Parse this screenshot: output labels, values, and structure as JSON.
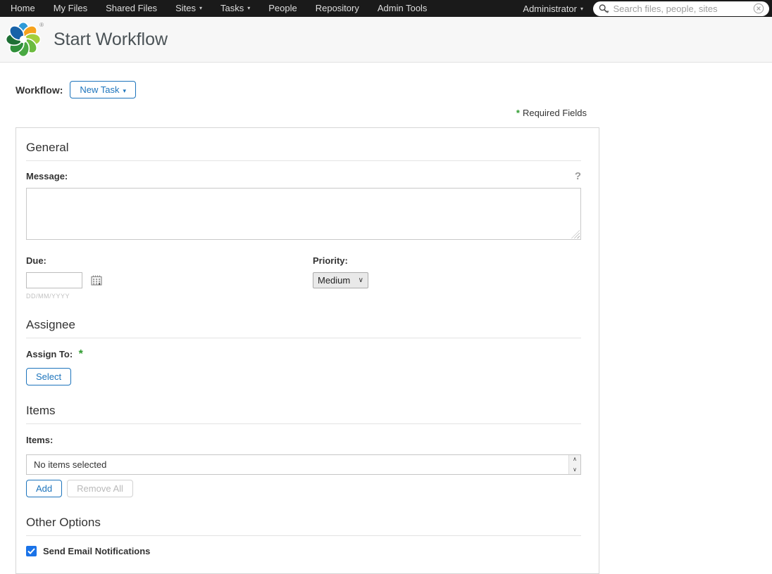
{
  "nav": {
    "items": [
      {
        "label": "Home",
        "has_dropdown": false
      },
      {
        "label": "My Files",
        "has_dropdown": false
      },
      {
        "label": "Shared Files",
        "has_dropdown": false
      },
      {
        "label": "Sites",
        "has_dropdown": true
      },
      {
        "label": "Tasks",
        "has_dropdown": true
      },
      {
        "label": "People",
        "has_dropdown": false
      },
      {
        "label": "Repository",
        "has_dropdown": false
      },
      {
        "label": "Admin Tools",
        "has_dropdown": false
      }
    ],
    "user_menu_label": "Administrator",
    "search": {
      "placeholder": "Search files, people, sites"
    }
  },
  "header": {
    "title": "Start Workflow"
  },
  "workflow": {
    "label": "Workflow:",
    "selector_button": "New Task"
  },
  "required_note": {
    "star": "*",
    "text": "Required Fields"
  },
  "form": {
    "general": {
      "heading": "General",
      "message_label": "Message:",
      "message_value": "",
      "due_label": "Due:",
      "due_value": "",
      "due_hint": "DD/MM/YYYY",
      "priority_label": "Priority:",
      "priority_selected": "Medium"
    },
    "assignee": {
      "heading": "Assignee",
      "assign_to_label": "Assign To:",
      "required_star": "*",
      "select_button": "Select"
    },
    "items": {
      "heading": "Items",
      "label": "Items:",
      "empty_text": "No items selected",
      "add_button": "Add",
      "remove_all_button": "Remove All"
    },
    "other": {
      "heading": "Other Options",
      "email_label": "Send Email Notifications",
      "email_checked": true
    }
  },
  "icons": {
    "caret_down": "▾",
    "help": "?",
    "scroll_up": "∧",
    "scroll_down": "∨",
    "select_chevron": "∨"
  },
  "colors": {
    "nav_bg": "#1a1a1a",
    "accent_blue": "#1d74bc",
    "required_green": "#2e9b2e",
    "checkbox_blue": "#1a73e8",
    "title_gray": "#4b5357",
    "band_bg": "#f7f7f7"
  }
}
